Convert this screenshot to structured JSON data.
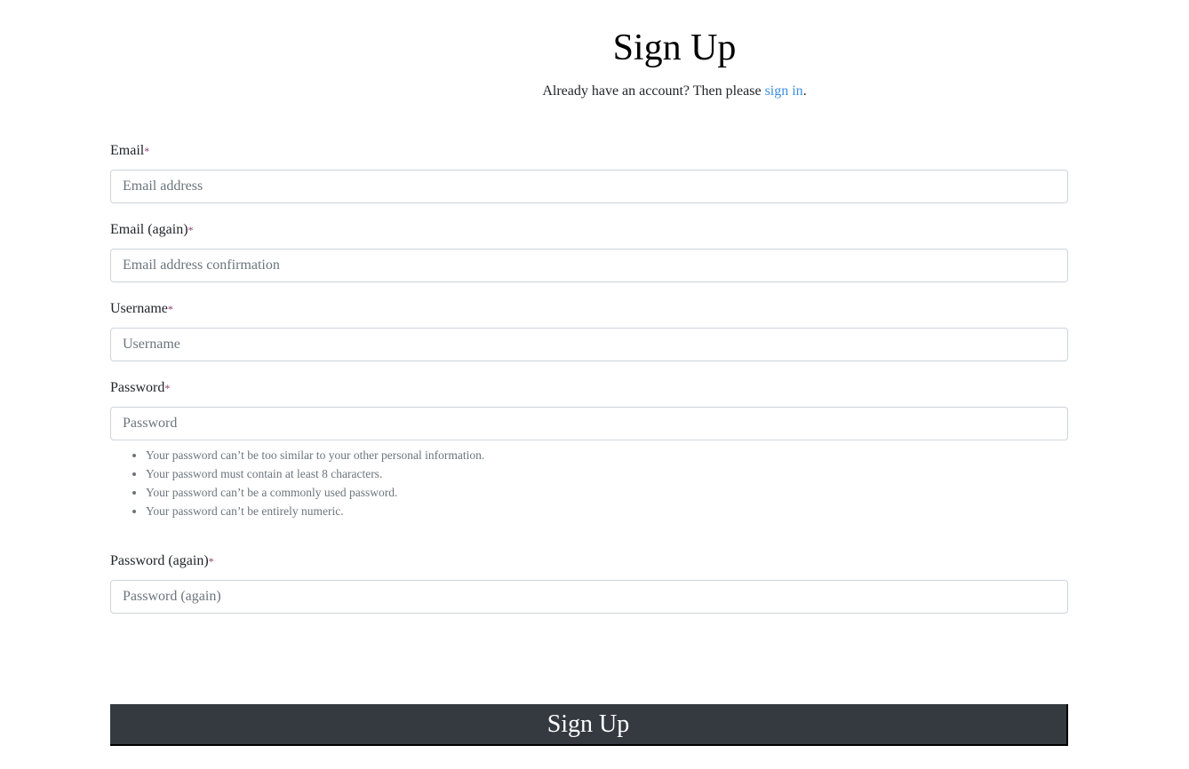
{
  "header": {
    "title": "Sign Up",
    "subtitle_prefix": "Already have an account? Then please ",
    "signin_link": "sign in",
    "subtitle_suffix": "."
  },
  "form": {
    "required_mark": "*",
    "fields": [
      {
        "label": "Email",
        "placeholder": "Email address"
      },
      {
        "label": "Email (again)",
        "placeholder": "Email address confirmation"
      },
      {
        "label": "Username",
        "placeholder": "Username"
      },
      {
        "label": "Password",
        "placeholder": "Password"
      },
      {
        "label": "Password (again)",
        "placeholder": "Password (again)"
      }
    ],
    "password_help": [
      "Your password can’t be too similar to your other personal information.",
      "Your password must contain at least 8 characters.",
      "Your password can’t be a commonly used password.",
      "Your password can’t be entirely numeric."
    ],
    "submit_label": "Sign Up"
  },
  "colors": {
    "link": "#3d8fe0",
    "button": "#343a40"
  }
}
